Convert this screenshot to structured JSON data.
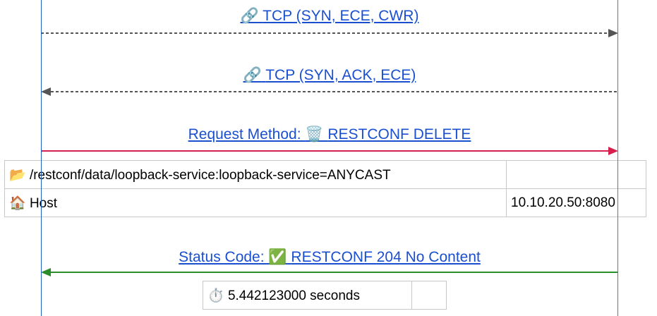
{
  "messages": [
    {
      "icon": "🔗",
      "text": "TCP (SYN, ECE, CWR)",
      "direction": "right",
      "style": "dashed",
      "color": "#555555"
    },
    {
      "icon": "🔗",
      "text": "TCP (SYN, ACK, ECE)",
      "direction": "left",
      "style": "dashed",
      "color": "#555555"
    },
    {
      "prefix": "Request Method: ",
      "icon": "🗑️",
      "text": "RESTCONF DELETE",
      "direction": "right",
      "style": "solid",
      "color": "#d6204e"
    },
    {
      "prefix": "Status Code: ",
      "icon": "✅",
      "text": "RESTCONF 204 No Content",
      "direction": "left",
      "style": "solid",
      "color": "#2a8c2a"
    }
  ],
  "request_table": {
    "rows": [
      {
        "icon": "📂",
        "key": "/restconf/data/loopback-service:loopback-service=ANYCAST",
        "value": ""
      },
      {
        "icon": "🏠",
        "key": "Host",
        "value": "10.10.20.50:8080"
      }
    ]
  },
  "timing": {
    "icon": "⏱️",
    "text": "5.442123000 seconds",
    "value": ""
  }
}
